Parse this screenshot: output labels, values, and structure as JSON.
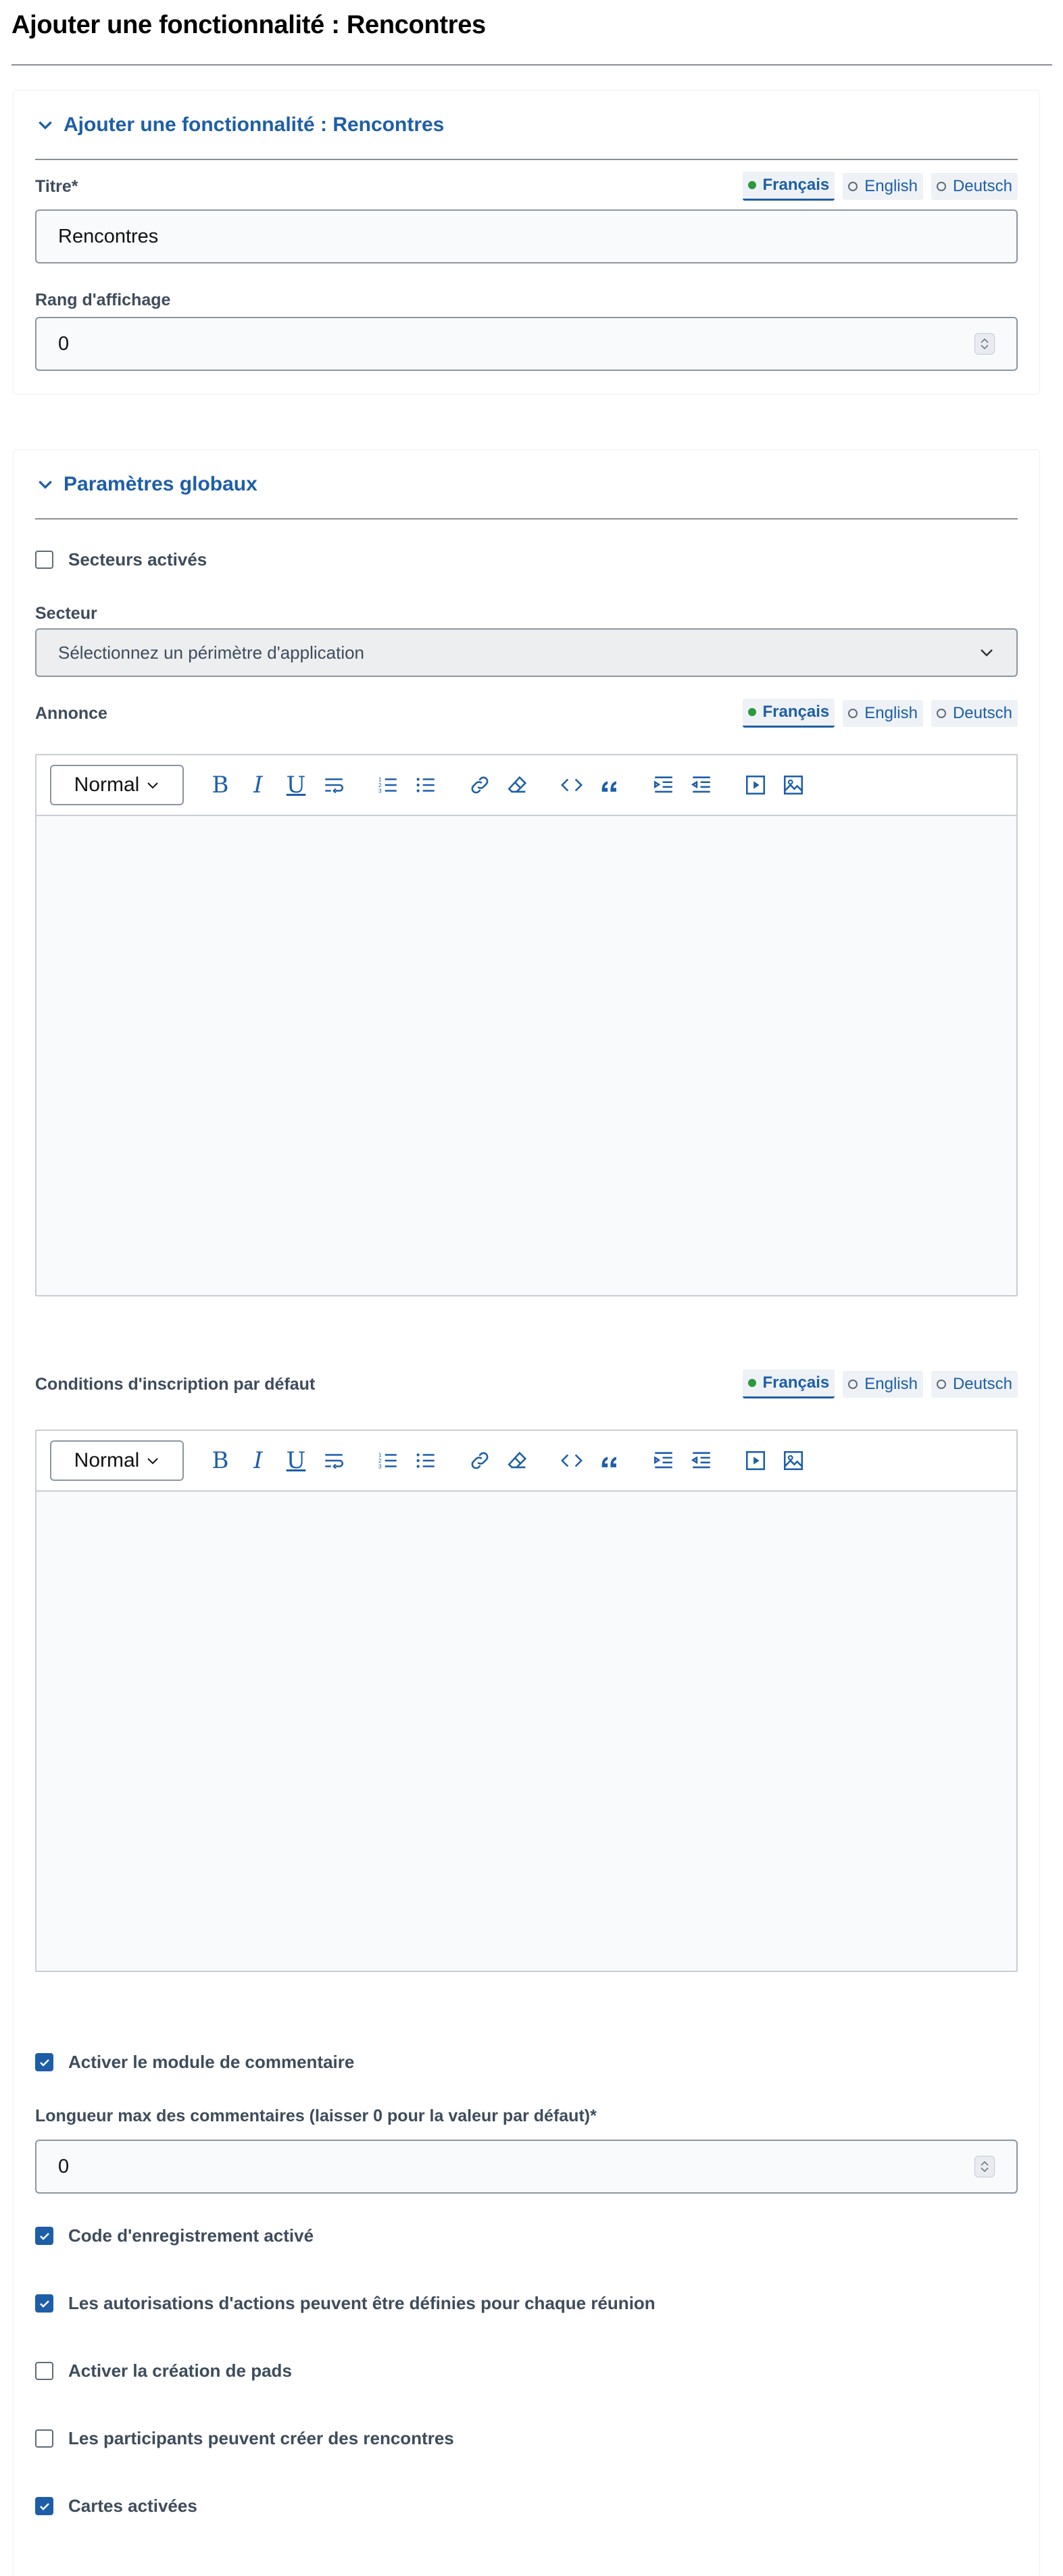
{
  "page": {
    "title": "Ajouter une fonctionnalité : Rencontres"
  },
  "section1": {
    "toggle_label": "Ajouter une fonctionnalité : Rencontres",
    "title_label": "Titre*",
    "title_value": "Rencontres",
    "rank_label": "Rang d'affichage",
    "rank_value": "0"
  },
  "languages": [
    "Français",
    "English",
    "Deutsch"
  ],
  "section2": {
    "toggle_label": "Paramètres globaux",
    "sectors_enabled_label": "Secteurs activés",
    "sectors_enabled": false,
    "sector_label": "Secteur",
    "sector_select_value": "Sélectionnez un périmètre d'application",
    "announcement_label": "Annonce",
    "registration_terms_label": "Conditions d'inscription par défaut",
    "comments_enabled_label": "Activer le module de commentaire",
    "comments_enabled": true,
    "comment_max_label": "Longueur max des commentaires (laisser 0 pour la valeur par défaut)*",
    "comment_max_value": "0",
    "registration_code_label": "Code d'enregistrement activé",
    "registration_code": true,
    "action_permissions_label": "Les autorisations d'actions peuvent être définies pour chaque réunion",
    "action_permissions": true,
    "pads_label": "Activer la création de pads",
    "pads": false,
    "participants_create_label": "Les participants peuvent créer des rencontres",
    "participants_create": false,
    "maps_label": "Cartes activées",
    "maps": true
  },
  "editor": {
    "heading_select_value": "Normal",
    "buttons": [
      "bold",
      "italic",
      "underline",
      "wrap",
      "ordered-list",
      "bullet-list",
      "link",
      "clear-format",
      "code",
      "quote",
      "indent",
      "outdent",
      "video",
      "image"
    ]
  },
  "colors": {
    "accent": "#1e5ea8",
    "active_dot": "#2a9a3c",
    "text": "#3e4c5c"
  }
}
